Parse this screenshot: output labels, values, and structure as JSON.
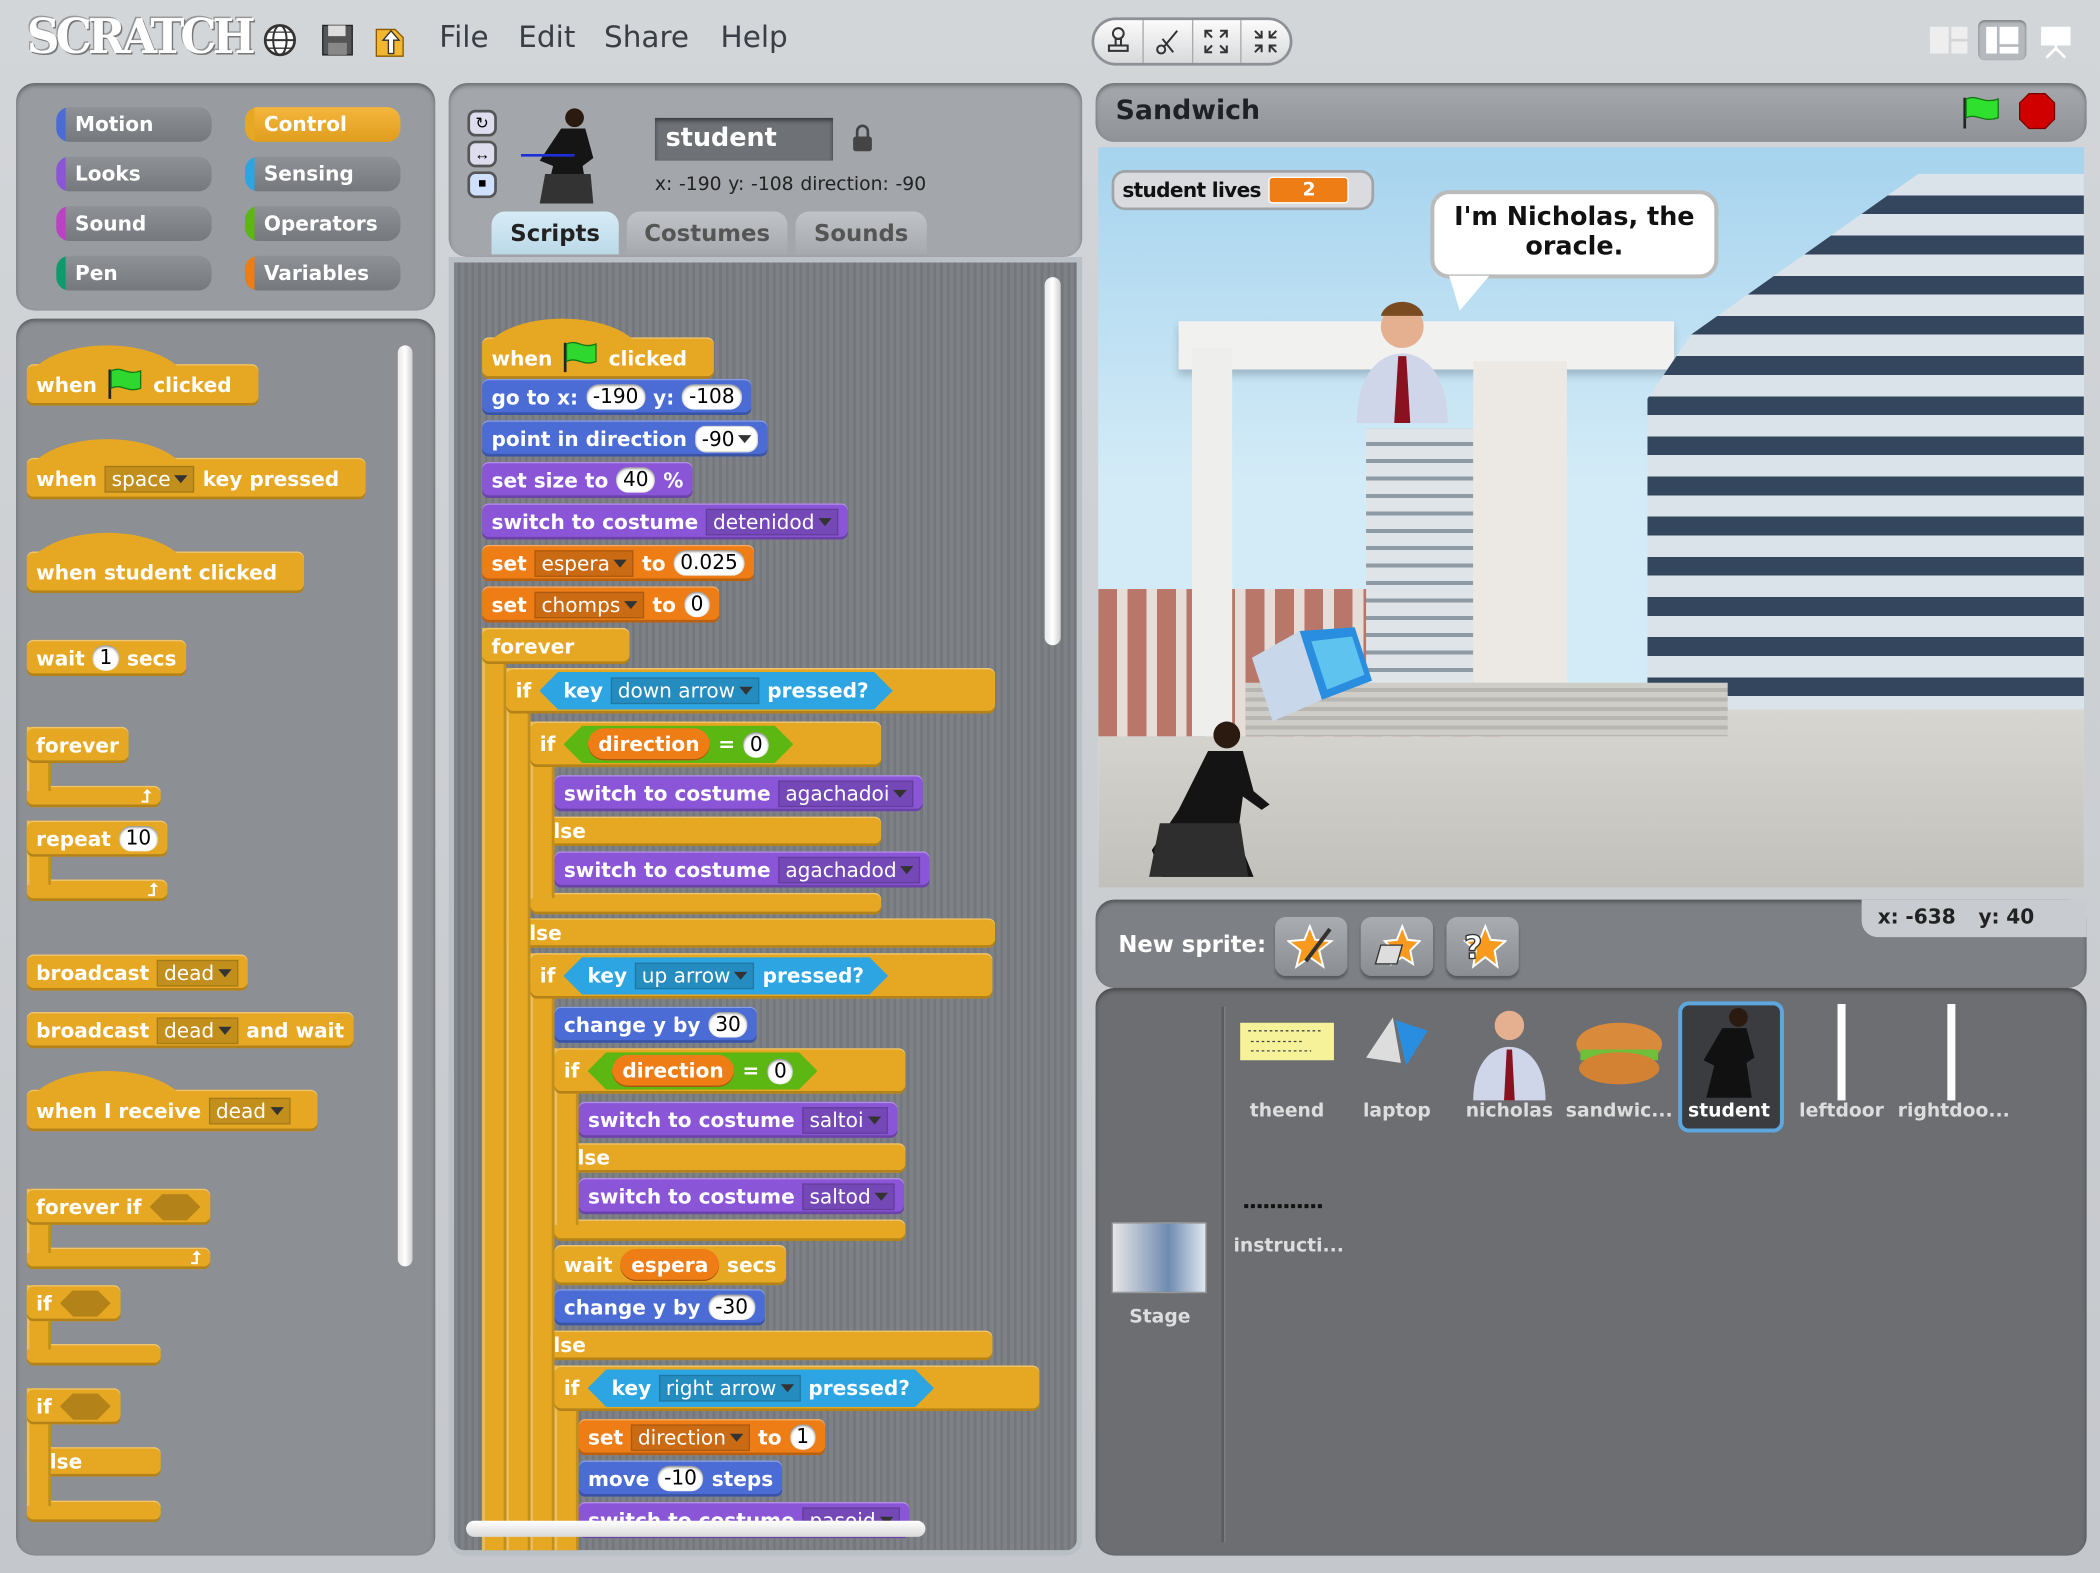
{
  "app": {
    "logo": "SCRATCH"
  },
  "menu": [
    "File",
    "Edit",
    "Share",
    "Help"
  ],
  "toolbar_icons": [
    "globe-icon",
    "save-icon",
    "share-icon"
  ],
  "edit_tools": [
    "stamp-icon",
    "scissors-icon",
    "grow-icon",
    "shrink-icon"
  ],
  "view_modes": [
    "small-stage-icon",
    "normal-view-icon",
    "presentation-icon"
  ],
  "categories": [
    {
      "label": "Motion",
      "color": "#4a6cd4"
    },
    {
      "label": "Control",
      "color": "#e6a822",
      "selected": true
    },
    {
      "label": "Looks",
      "color": "#8a55d7"
    },
    {
      "label": "Sensing",
      "color": "#2ca5e2"
    },
    {
      "label": "Sound",
      "color": "#bb42c3"
    },
    {
      "label": "Operators",
      "color": "#5cb712"
    },
    {
      "label": "Pen",
      "color": "#0e9a6c"
    },
    {
      "label": "Variables",
      "color": "#ee7d16"
    }
  ],
  "colors": {
    "control": "#e6a822",
    "motion": "#4a6cd4",
    "looks": "#8a55d7",
    "variables": "#ee7d16",
    "sensing": "#2ca5e2",
    "operators": "#5cb712"
  },
  "palette": [
    [
      {
        "type": "hat",
        "cat": "control",
        "parts": [
          "when",
          {
            "icon": "green-flag"
          },
          "clicked"
        ]
      }
    ],
    [
      {
        "type": "hat",
        "cat": "control",
        "parts": [
          "when",
          {
            "drop": "space"
          },
          "key pressed"
        ]
      }
    ],
    [
      {
        "type": "hat",
        "cat": "control",
        "parts": [
          "when student clicked"
        ]
      }
    ],
    [
      {
        "type": "stack",
        "cat": "control",
        "parts": [
          "wait",
          {
            "num": "1"
          },
          "secs"
        ]
      }
    ],
    [
      {
        "type": "c",
        "cat": "control",
        "parts": [
          "forever"
        ]
      },
      {
        "type": "end",
        "arrow": true
      }
    ],
    [
      {
        "type": "c",
        "cat": "control",
        "parts": [
          "repeat",
          {
            "num": "10"
          }
        ]
      },
      {
        "type": "end",
        "arrow": true
      }
    ],
    [
      {
        "type": "stack",
        "cat": "control",
        "parts": [
          "broadcast",
          {
            "drop": "dead"
          }
        ]
      }
    ],
    [
      {
        "type": "stack",
        "cat": "control",
        "parts": [
          "broadcast",
          {
            "drop": "dead"
          },
          "and wait"
        ]
      }
    ],
    [
      {
        "type": "hat",
        "cat": "control",
        "parts": [
          "when I receive",
          {
            "drop": "dead"
          }
        ]
      }
    ],
    [
      {
        "type": "c",
        "cat": "control",
        "parts": [
          "forever if",
          {
            "slot": true
          }
        ]
      },
      {
        "type": "end",
        "arrow": true
      }
    ],
    [
      {
        "type": "c",
        "cat": "control",
        "parts": [
          "if",
          {
            "slot": true
          }
        ]
      },
      {
        "type": "end"
      }
    ],
    [
      {
        "type": "c",
        "cat": "control",
        "parts": [
          "if",
          {
            "slot": true
          }
        ]
      },
      {
        "type": "else",
        "parts": [
          "else"
        ]
      },
      {
        "type": "end"
      }
    ]
  ],
  "sprite": {
    "name": "student",
    "x_label": "x:",
    "x": "-190",
    "y_label": "y:",
    "y": "-108",
    "direction_label": "direction:",
    "direction": "-90",
    "tabs": [
      "Scripts",
      "Costumes",
      "Sounds"
    ],
    "active_tab": "Scripts"
  },
  "script": [
    {
      "d": 0,
      "type": "hat",
      "cat": "control",
      "parts": [
        "when",
        {
          "icon": "green-flag"
        },
        "clicked"
      ]
    },
    {
      "d": 0,
      "type": "stack",
      "cat": "motion",
      "parts": [
        "go to x:",
        {
          "num": "-190"
        },
        "y:",
        {
          "num": "-108"
        }
      ]
    },
    {
      "d": 0,
      "type": "stack",
      "cat": "motion",
      "parts": [
        "point in direction",
        {
          "drop": "-90",
          "num": true
        }
      ]
    },
    {
      "d": 0,
      "type": "stack",
      "cat": "looks",
      "parts": [
        "set size to",
        {
          "num": "40"
        },
        "%"
      ]
    },
    {
      "d": 0,
      "type": "stack",
      "cat": "looks",
      "parts": [
        "switch to costume",
        {
          "drop": "detenidod"
        }
      ]
    },
    {
      "d": 0,
      "type": "stack",
      "cat": "variables",
      "parts": [
        "set",
        {
          "drop": "espera"
        },
        "to",
        {
          "num": "0.025"
        }
      ]
    },
    {
      "d": 0,
      "type": "stack",
      "cat": "variables",
      "parts": [
        "set",
        {
          "drop": "chomps"
        },
        "to",
        {
          "num": "0"
        }
      ]
    },
    {
      "d": 0,
      "type": "c",
      "cat": "control",
      "parts": [
        "forever"
      ],
      "w": 110
    },
    {
      "d": 1,
      "type": "c",
      "cat": "control",
      "parts": [
        "if",
        {
          "bool": [
            "key",
            {
              "drop": "down arrow"
            },
            "pressed?"
          ]
        }
      ],
      "w": 365
    },
    {
      "d": 2,
      "type": "c",
      "cat": "control",
      "parts": [
        "if",
        {
          "op": [
            {
              "var": "direction"
            },
            "=",
            {
              "num": "0"
            }
          ]
        }
      ],
      "w": 262
    },
    {
      "d": 3,
      "type": "stack",
      "cat": "looks",
      "parts": [
        "switch to costume",
        {
          "drop": "agachadoi"
        }
      ]
    },
    {
      "d": 2,
      "type": "else",
      "cat": "control",
      "parts": [
        "else"
      ]
    },
    {
      "d": 3,
      "type": "stack",
      "cat": "looks",
      "parts": [
        "switch to costume",
        {
          "drop": "agachadod"
        }
      ]
    },
    {
      "d": 2,
      "type": "end",
      "cat": "control"
    },
    {
      "d": 1,
      "type": "else",
      "cat": "control",
      "parts": [
        "else"
      ]
    },
    {
      "d": 2,
      "type": "c",
      "cat": "control",
      "parts": [
        "if",
        {
          "bool": [
            "key",
            {
              "drop": "up arrow"
            },
            "pressed?"
          ]
        }
      ],
      "w": 345
    },
    {
      "d": 3,
      "type": "stack",
      "cat": "motion",
      "parts": [
        "change y by",
        {
          "num": "30"
        }
      ]
    },
    {
      "d": 3,
      "type": "c",
      "cat": "control",
      "parts": [
        "if",
        {
          "op": [
            {
              "var": "direction"
            },
            "=",
            {
              "num": "0"
            }
          ]
        }
      ],
      "w": 262
    },
    {
      "d": 4,
      "type": "stack",
      "cat": "looks",
      "parts": [
        "switch to costume",
        {
          "drop": "saltoi"
        }
      ]
    },
    {
      "d": 3,
      "type": "else",
      "cat": "control",
      "parts": [
        "else"
      ]
    },
    {
      "d": 4,
      "type": "stack",
      "cat": "looks",
      "parts": [
        "switch to costume",
        {
          "drop": "saltod"
        }
      ]
    },
    {
      "d": 3,
      "type": "end",
      "cat": "control"
    },
    {
      "d": 3,
      "type": "stack",
      "cat": "control",
      "parts": [
        "wait",
        {
          "var": "espera"
        },
        "secs"
      ]
    },
    {
      "d": 3,
      "type": "stack",
      "cat": "motion",
      "parts": [
        "change y by",
        {
          "num": "-30"
        }
      ]
    },
    {
      "d": 2,
      "type": "else",
      "cat": "control",
      "parts": [
        "else"
      ]
    },
    {
      "d": 3,
      "type": "c",
      "cat": "control",
      "parts": [
        "if",
        {
          "bool": [
            "key",
            {
              "drop": "right arrow"
            },
            "pressed?"
          ]
        }
      ],
      "w": 362
    },
    {
      "d": 4,
      "type": "stack",
      "cat": "variables",
      "parts": [
        "set",
        {
          "drop": "direction"
        },
        "to",
        {
          "num": "1"
        }
      ]
    },
    {
      "d": 4,
      "type": "stack",
      "cat": "motion",
      "parts": [
        "move",
        {
          "num": "-10"
        },
        "steps"
      ]
    },
    {
      "d": 4,
      "type": "stack",
      "cat": "looks",
      "parts": [
        "switch to costume",
        {
          "drop": "pasoid"
        }
      ]
    }
  ],
  "stage": {
    "title": "Sandwich",
    "monitor": {
      "label": "student lives",
      "value": "2"
    },
    "speech": "I'm Nicholas, the oracle.",
    "mouse": {
      "x_label": "x:",
      "x": "-638",
      "y_label": "y:",
      "y": "40"
    }
  },
  "new_sprite": {
    "label": "New sprite:",
    "buttons": [
      "paint-new-sprite-icon",
      "choose-sprite-file-icon",
      "random-sprite-icon"
    ]
  },
  "sprites": [
    {
      "name": "theend"
    },
    {
      "name": "laptop"
    },
    {
      "name": "nicholas"
    },
    {
      "name": "sandwic..."
    },
    {
      "name": "student",
      "selected": true
    },
    {
      "name": "leftdoor"
    },
    {
      "name": "rightdoo..."
    },
    {
      "name": "instructi..."
    }
  ],
  "stage_thumb": {
    "label": "Stage"
  }
}
